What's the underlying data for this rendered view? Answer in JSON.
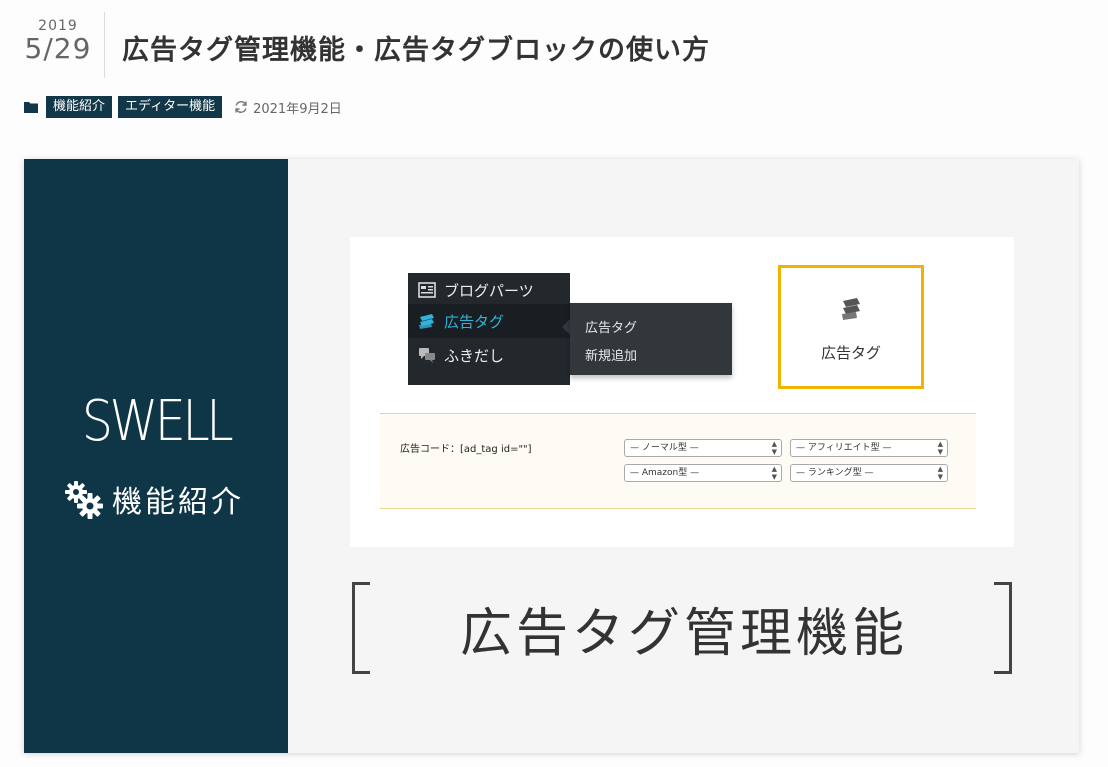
{
  "post": {
    "date": {
      "year": "2019",
      "month_day": "5/29"
    },
    "title": "広告タグ管理機能・広告タグブロックの使い方",
    "categories": [
      {
        "label": "機能紹介"
      },
      {
        "label": "エディター機能"
      }
    ],
    "updated": "2021年9月2日"
  },
  "thumbnail": {
    "left": {
      "logo_text": "SWELL",
      "feature_label": "機能紹介",
      "bg_color": "#0e3647"
    },
    "wp_menu": {
      "items": [
        {
          "label": "ブログパーツ",
          "icon": "blog-parts-icon"
        },
        {
          "label": "広告タグ",
          "icon": "ad-tag-icon",
          "active": true
        },
        {
          "label": "ふきだし",
          "icon": "speech-bubble-icon"
        }
      ],
      "submenu": [
        {
          "label": "広告タグ"
        },
        {
          "label": "新規追加"
        }
      ]
    },
    "block_preview": {
      "label": "広告タグ",
      "border_color": "#f0b400"
    },
    "code_panel": {
      "label": "広告コード：[ad_tag id=\"\"]",
      "selects": [
        {
          "label": "— ノーマル型 —"
        },
        {
          "label": "— アフィリエイト型 —"
        },
        {
          "label": "— Amazon型 —"
        },
        {
          "label": "— ランキング型 —"
        }
      ]
    },
    "big_title": "広告タグ管理機能"
  },
  "colors": {
    "accent_dark": "#113748",
    "wp_admin_bg": "#23282d",
    "wp_active_text": "#33b3db"
  }
}
